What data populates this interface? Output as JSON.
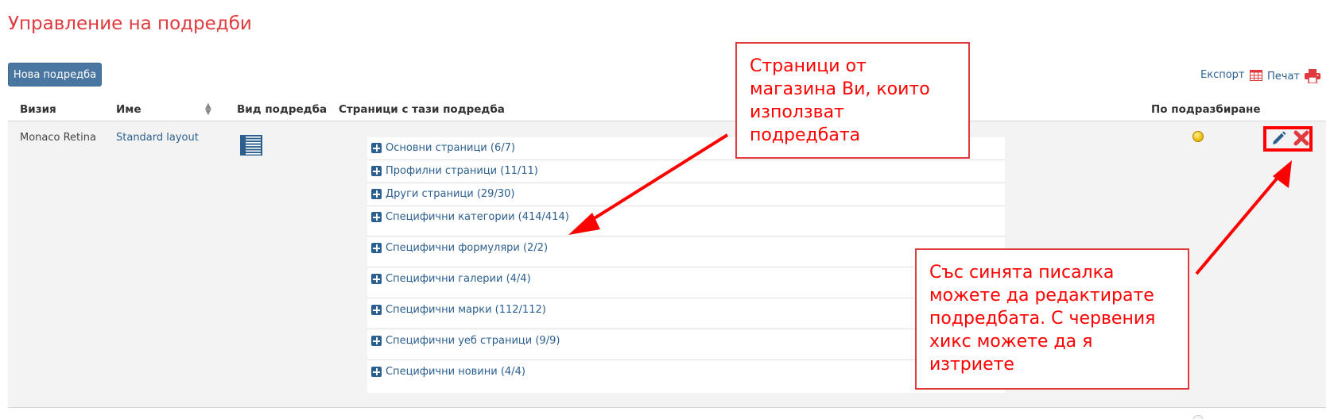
{
  "page": {
    "title": "Управление на подредби"
  },
  "toolbar": {
    "new_label": "Нова подредба",
    "export_label": "Експорт",
    "print_label": "Печат"
  },
  "table": {
    "columns": [
      "Визия",
      "Име",
      "Вид подредба",
      "Страници с тази подредба",
      "По подразбиране"
    ],
    "rows": [
      {
        "vision": "Monaco Retina",
        "name": "Standard layout",
        "pages": [
          "Основни страници (6/7)",
          "Профилни страници (11/11)",
          "Други страници (29/30)",
          "Специфични категории (414/414)",
          "Специфични формуляри (2/2)",
          "Специфични галерии (4/4)",
          "Специфични марки (112/112)",
          "Специфични уеб страници (9/9)",
          "Специфични новини (4/4)"
        ],
        "is_default": true
      }
    ]
  },
  "annotations": {
    "callout_pages": "Страници от\nмагазина Ви, които\nизползват\nподредбата",
    "callout_actions": "Със синята писалка\nможете да редактирате\nподредбата. С червения\nхикс можете да я\nизтриете"
  },
  "icons": {
    "export": "table-grid-icon",
    "print": "printer-icon",
    "layout": "list-layout-icon",
    "expand": "plus-square-icon",
    "default": "yellow-dot-icon",
    "edit": "pencil-icon",
    "delete": "red-x-icon"
  },
  "colors": {
    "title": "#e0393e",
    "primary_button": "#4a77a1",
    "link": "#2b5f8f",
    "annotation": "#ff0000",
    "delete": "#e0393e"
  }
}
